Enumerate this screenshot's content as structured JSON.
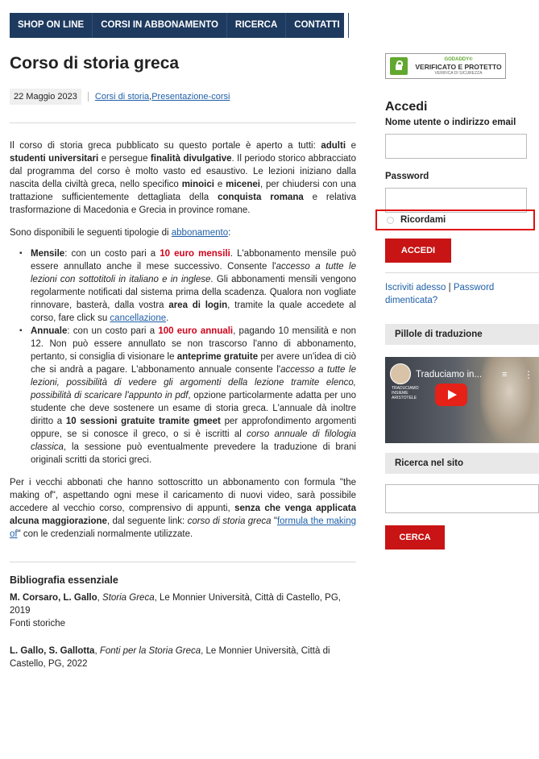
{
  "nav": [
    "SHOP ON LINE",
    "CORSI IN ABBONAMENTO",
    "RICERCA",
    "CONTATTI"
  ],
  "article": {
    "title": "Corso di storia greca",
    "date": "22 Maggio 2023",
    "categories": [
      "Corsi di storia",
      "Presentazione-corsi"
    ],
    "category_separator": ", ",
    "intro": {
      "t1": "Il corso di storia greca pubblicato su questo portale è aperto a tutti: ",
      "b1": "adulti",
      "t2": " e ",
      "b2": "studenti universitari",
      "t3": " e persegue ",
      "b3": "finalità divulgative",
      "t4": ". Il periodo storico abbracciato dal programma del corso è molto vasto ed esaustivo. Le lezioni iniziano dalla nascita della civiltà greca, nello specifico ",
      "b4": "minoici",
      "t5": " e ",
      "b5": "micenei",
      "t6": ", per chiudersi con una trattazione sufficientemente dettagliata della ",
      "b6": "conquista romana",
      "t7": " e relativa trasformazione di Macedonia e Grecia in province romane."
    },
    "types_intro": "Sono disponibili le seguenti tipologie di ",
    "types_link": "abbonamento",
    "types_colon": ":",
    "monthly": {
      "label": "Mensile",
      "t1": ": con un costo pari a ",
      "price": "10 euro mensili",
      "t2": ". L'abbonamento mensile può essere annullato anche il mese successivo. Consente l'",
      "i1": "accesso a tutte le lezioni con sottotitoli in italiano e in inglese",
      "t3": ". Gli abbonamenti mensili vengono regolarmente notificati dal sistema prima della scadenza. Qualora non vogliate rinnovare, basterà, dalla vostra ",
      "b1": "area di login",
      "t4": ", tramite la quale accedete al corso, fare click su ",
      "link": "cancellazione",
      "t5": "."
    },
    "annual": {
      "label": "Annuale",
      "t1": ": con un costo pari a ",
      "price": "100 euro annuali",
      "t2": ", pagando 10 mensilità e non 12. Non può essere annullato se non trascorso l'anno di abbonamento, pertanto, si consiglia di visionare le ",
      "b1": "anteprime gratuite",
      "t3": " per avere un'idea di ciò che si andrà a pagare. L'abbonamento annuale consente l'",
      "i1": "accesso a tutte le lezioni, possibilità di vedere gli argomenti della lezione tramite elenco, possibilità di scaricare l'appunto in pdf",
      "t4": ", opzione particolarmente adatta per uno studente che deve sostenere un esame di storia greca. L'annuale dà inoltre diritto a ",
      "b2": "10 sessioni gratuite tramite gmeet",
      "t5": " per approfondimento argomenti oppure, se si conosce il greco, o si è iscritti al ",
      "i2": "corso annuale di filologia classica",
      "t6": ", la sessione può eventualmente prevedere la traduzione di brani originali scritti da storici greci."
    },
    "old": {
      "t1": "Per i vecchi abbonati che hanno sottoscritto un abbonamento con formula \"the making of\", aspettando ogni mese il caricamento di nuovi video, sarà possibile accedere al vecchio corso, comprensivo di appunti, ",
      "b1": "senza che venga applicata alcuna maggiorazione",
      "t2": ", dal seguente link: ",
      "i1": "corso di storia greca",
      "q_open": " \"",
      "link": "formula the making of",
      "q_close": "\"",
      "t3": " con le credenziali normalmente utilizzate."
    },
    "biblio_title": "Bibliografia essenziale",
    "biblio": [
      {
        "authors": "M. Corsaro, L. Gallo",
        "sep": ", ",
        "work": "Storia Greca",
        "rest": ", Le Monnier Università, Città di Castello, PG, 2019",
        "note": "Fonti storiche"
      },
      {
        "authors": "L. Gallo, S. Gallotta",
        "sep": ", ",
        "work": "Fonti per la Storia Greca",
        "rest": ", Le Monnier Università, Città di Castello, PG, 2022",
        "note": ""
      }
    ]
  },
  "sidebar": {
    "badge": {
      "brand": "GODADDY®",
      "main": "VERIFICATO E PROTETTO",
      "sub": "VERIFICA DI SICUREZZA"
    },
    "login_title": "Accedi",
    "username_label": "Nome utente o indirizzo email",
    "password_label": "Password",
    "remember_label": "Ricordami",
    "login_button": "ACCEDI",
    "register_link": "Iscriviti adesso",
    "links_separator": " | ",
    "forgot_link": "Password dimenticata?",
    "pills_title": "Pillole di traduzione",
    "video_title": "Traduciamo in...",
    "video_caption": "TRADUCIAMO INSIEME ARISTOTELE",
    "search_title": "Ricerca nel sito",
    "search_button": "CERCA"
  },
  "icons": {
    "lock": "lock-icon",
    "play": "play-icon",
    "menu": "more-vert-icon",
    "queue": "queue-icon"
  },
  "colors": {
    "nav_bg": "#1e3a5f",
    "button_red": "#c81414",
    "price_red": "#d0021b",
    "link": "#1f5fa8",
    "highlight_border": "#e01010"
  }
}
